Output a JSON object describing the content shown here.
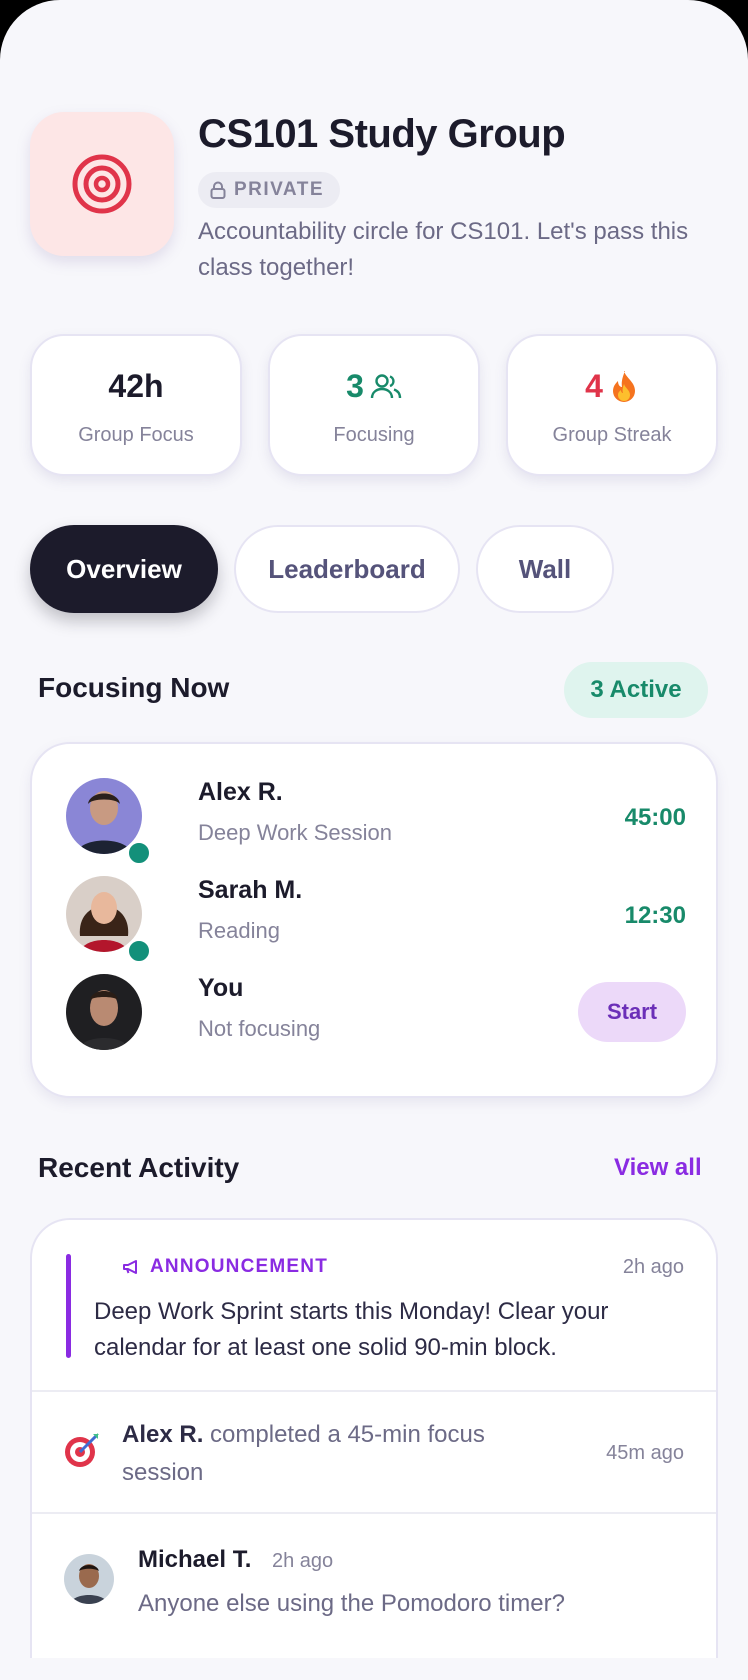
{
  "group": {
    "title": "CS101 Study Group",
    "privacy": "PRIVATE",
    "description": "Accountability circle for CS101. Let's pass this class together!",
    "icon": "target-icon"
  },
  "stats": [
    {
      "value": "42h",
      "label": "Group Focus",
      "color": "#1c1b2b",
      "icon": ""
    },
    {
      "value": "3",
      "label": "Focusing",
      "color": "#188a6a",
      "icon": "people-icon"
    },
    {
      "value": "4",
      "label": "Group Streak",
      "color": "#e0344a",
      "icon": "fire-icon"
    }
  ],
  "tabs": [
    {
      "label": "Overview",
      "active": true
    },
    {
      "label": "Leaderboard",
      "active": false
    },
    {
      "label": "Wall",
      "active": false
    }
  ],
  "focusing_now": {
    "title": "Focusing Now",
    "active_badge": "3 Active",
    "members": [
      {
        "name": "Alex R.",
        "status": "Deep Work Session",
        "timer": "45:00",
        "online": true
      },
      {
        "name": "Sarah M.",
        "status": "Reading",
        "timer": "12:30",
        "online": true
      },
      {
        "name": "You",
        "status": "Not focusing",
        "action": "Start",
        "online": false
      }
    ]
  },
  "recent_activity": {
    "title": "Recent Activity",
    "view_all": "View all",
    "announcement": {
      "label": "ANNOUNCEMENT",
      "time": "2h ago",
      "text": "Deep Work Sprint starts this Monday! Clear your calendar for at least one solid 90-min block."
    },
    "event": {
      "user": "Alex R.",
      "text": " completed a 45-min focus session",
      "time": "45m ago"
    },
    "comment": {
      "author": "Michael T.",
      "time": "2h ago",
      "text": "Anyone else using the Pomodoro timer?"
    }
  },
  "colors": {
    "accent_purple": "#8a2be2",
    "accent_green": "#188a6a",
    "streak_red": "#e0344a",
    "dark": "#1c1b2b"
  }
}
